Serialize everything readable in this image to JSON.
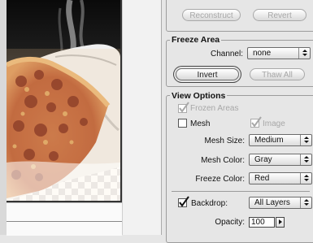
{
  "reconstruct_group": {
    "reconstruct_label": "Reconstruct",
    "revert_label": "Revert"
  },
  "freeze_area": {
    "title": "Freeze Area",
    "channel_label": "Channel:",
    "channel_value": "none",
    "invert_label": "Invert",
    "thaw_all_label": "Thaw All"
  },
  "view_options": {
    "title": "View Options",
    "frozen_areas_label": "Frozen Areas",
    "frozen_areas_checked": true,
    "mesh_label": "Mesh",
    "mesh_checked": false,
    "image_label": "Image",
    "image_checked": true,
    "mesh_size_label": "Mesh Size:",
    "mesh_size_value": "Medium",
    "mesh_color_label": "Mesh Color:",
    "mesh_color_value": "Gray",
    "freeze_color_label": "Freeze Color:",
    "freeze_color_value": "Red",
    "backdrop_label": "Backdrop:",
    "backdrop_checked": true,
    "backdrop_value": "All Layers",
    "opacity_label": "Opacity:",
    "opacity_value": "100"
  },
  "colors": {
    "panel_background": "#e6e6e6",
    "disabled_text": "#a7a7a7",
    "freeze_mask": "#f4c690"
  }
}
